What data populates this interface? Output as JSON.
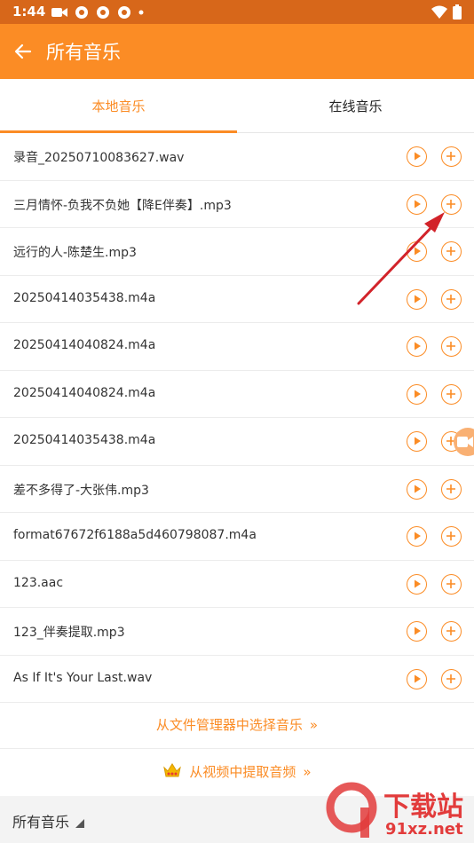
{
  "status_bar": {
    "time": "1:44"
  },
  "app_bar": {
    "title": "所有音乐"
  },
  "tabs": [
    {
      "label": "本地音乐",
      "active": true
    },
    {
      "label": "在线音乐",
      "active": false
    }
  ],
  "files": [
    "录音_20250710083627.wav",
    "三月情怀-负我不负她【降E伴奏】.mp3",
    "远行的人-陈楚生.mp3",
    "20250414035438.m4a",
    "20250414040824.m4a",
    "20250414040824.m4a",
    "20250414035438.m4a",
    "差不多得了-大张伟.mp3",
    "format67672f6188a5d460798087.m4a",
    "123.aac",
    "123_伴奏提取.mp3",
    "As If It's Your Last.wav"
  ],
  "links": {
    "choose_from_file_manager": "从文件管理器中选择音乐",
    "extract_from_video": "从视频中提取音频",
    "chevron": "»"
  },
  "bottom_bar": {
    "filter_label": "所有音乐"
  },
  "watermark": {
    "text": "下载站",
    "site": "91xz.net",
    "number": "9"
  },
  "colors": {
    "accent": "#fb8c25",
    "status_bar": "#d7671a",
    "arrow": "#d2232a"
  }
}
